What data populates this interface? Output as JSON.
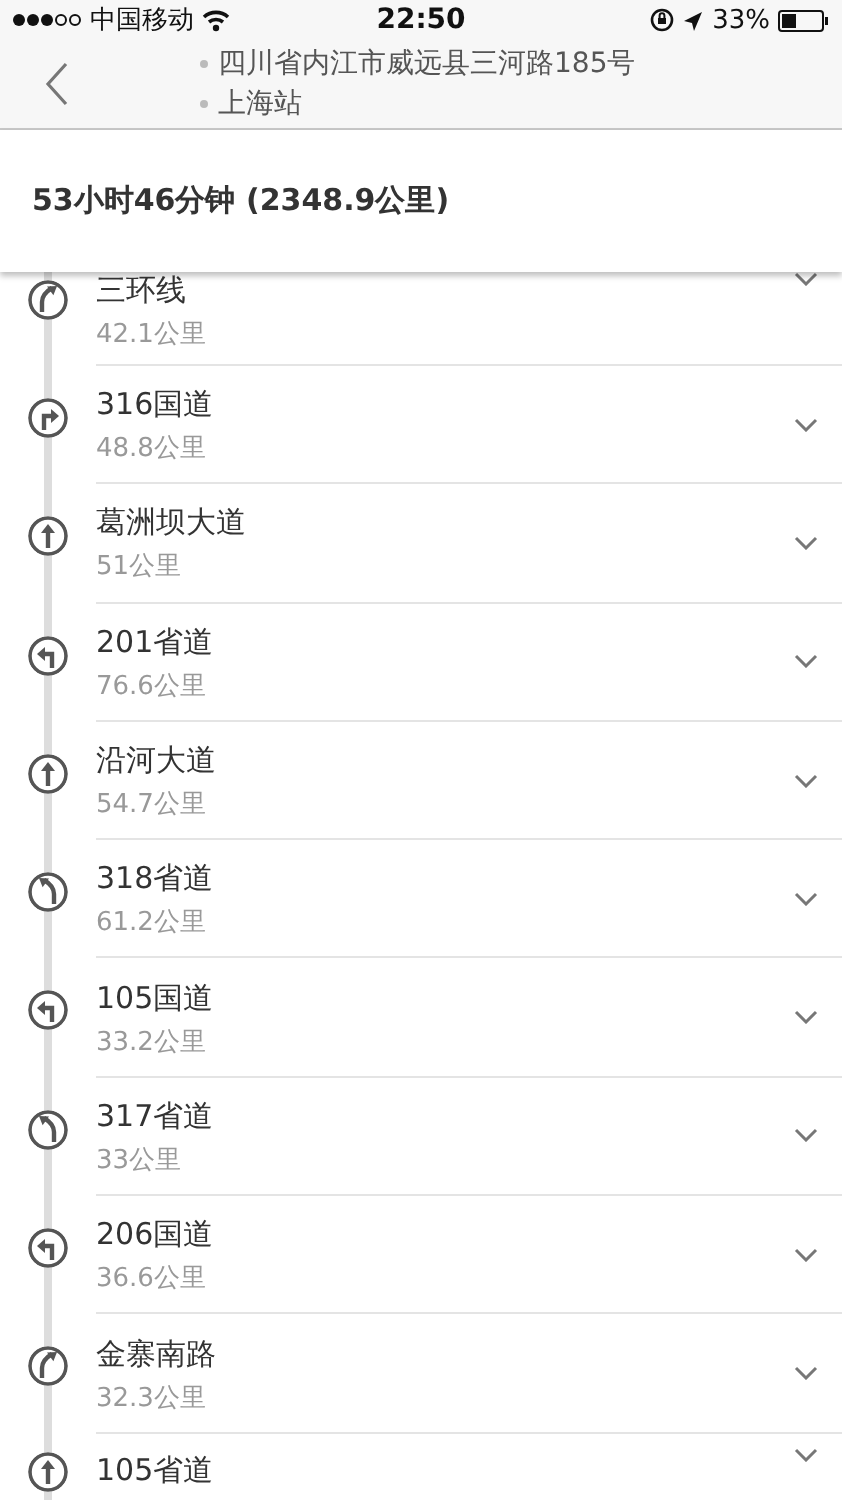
{
  "status_bar": {
    "carrier": "中国移动",
    "time": "22:50",
    "battery": "33%"
  },
  "header": {
    "stops": [
      "四川省内江市威远县三河路185号",
      "上海站"
    ]
  },
  "summary": {
    "text": "53小时46分钟 (2348.9公里)"
  },
  "steps": [
    {
      "road": "三环线",
      "distance": "42.1公里",
      "kind": "slight-right"
    },
    {
      "road": "316国道",
      "distance": "48.8公里",
      "kind": "right"
    },
    {
      "road": "葛洲坝大道",
      "distance": "51公里",
      "kind": "straight"
    },
    {
      "road": "201省道",
      "distance": "76.6公里",
      "kind": "left"
    },
    {
      "road": "沿河大道",
      "distance": "54.7公里",
      "kind": "straight"
    },
    {
      "road": "318省道",
      "distance": "61.2公里",
      "kind": "slight-left"
    },
    {
      "road": "105国道",
      "distance": "33.2公里",
      "kind": "left"
    },
    {
      "road": "317省道",
      "distance": "33公里",
      "kind": "slight-left"
    },
    {
      "road": "206国道",
      "distance": "36.6公里",
      "kind": "left"
    },
    {
      "road": "金寨南路",
      "distance": "32.3公里",
      "kind": "slight-right"
    },
    {
      "road": "105省道",
      "kind": "straight"
    }
  ]
}
